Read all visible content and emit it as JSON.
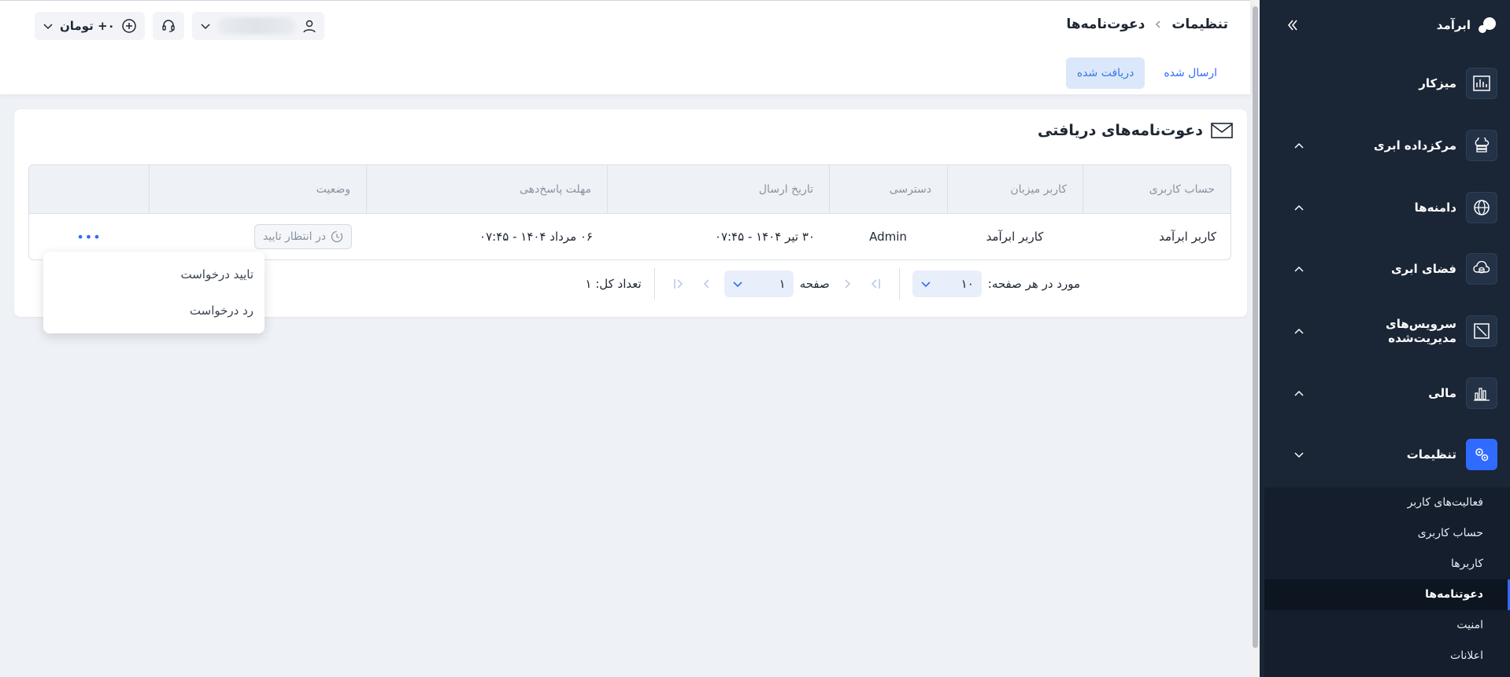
{
  "sidebar": {
    "logo_text": "ابرآمد",
    "items": [
      {
        "label": "میزکار",
        "icon": "dashboard-icon",
        "has_chevron": false
      },
      {
        "label": "مرکزداده ابری",
        "icon": "cloud-datacenter-icon",
        "has_chevron": true
      },
      {
        "label": "دامنه‌ها",
        "icon": "globe-icon",
        "has_chevron": true
      },
      {
        "label": "فضای ابری",
        "icon": "cloud-storage-icon",
        "has_chevron": true
      },
      {
        "label": "سرویس‌های مدیریت‌شده",
        "icon": "managed-services-icon",
        "has_chevron": true
      },
      {
        "label": "مالی",
        "icon": "finance-chart-icon",
        "has_chevron": true
      },
      {
        "label": "تنظیمات",
        "icon": "settings-gears-icon",
        "has_chevron": true
      }
    ],
    "sub_items": [
      {
        "label": "فعالیت‌های کاربر"
      },
      {
        "label": "حساب کاربری"
      },
      {
        "label": "کاربرها"
      },
      {
        "label": "دعوتنامه‌ها"
      },
      {
        "label": "امنیت"
      },
      {
        "label": "اعلانات"
      }
    ]
  },
  "header": {
    "breadcrumb": {
      "root": "تنظیمات",
      "current": "دعوت‌نامه‌ها"
    },
    "tabs": [
      {
        "label": "ارسال شده"
      },
      {
        "label": "دریافت شده"
      }
    ],
    "balance": "۰+ تومان"
  },
  "card": {
    "title": "دعوت‌نامه‌های دریافتی",
    "columns": [
      "حساب کاربری",
      "کاربر میزبان",
      "دسترسی",
      "تاریخ ارسال",
      "مهلت پاسخ‌دهی",
      "وضعیت"
    ],
    "rows": [
      {
        "account": "کاربر ابرآمد",
        "host": "کاربر ابرآمد",
        "access": "Admin",
        "sent_date": "۳۰ تیر ۱۴۰۴ - ۰۷:۴۵",
        "deadline": "۰۶ مرداد ۱۴۰۴ - ۰۷:۴۵",
        "status": "در انتظار تایید",
        "more": "•••"
      }
    ],
    "pager": {
      "per_page_label": "مورد در هر صفحه:",
      "per_page_value": "۱۰",
      "page_label": "صفحه",
      "page_value": "۱",
      "total_label": "تعداد کل: ۱"
    }
  },
  "dropdown": {
    "items": [
      {
        "label": "تایید درخواست"
      },
      {
        "label": "رد درخواست"
      }
    ]
  },
  "colors": {
    "sidebar_bg": "#1a2535",
    "accent": "#2f6bff",
    "page_bg": "#eef1f6"
  }
}
